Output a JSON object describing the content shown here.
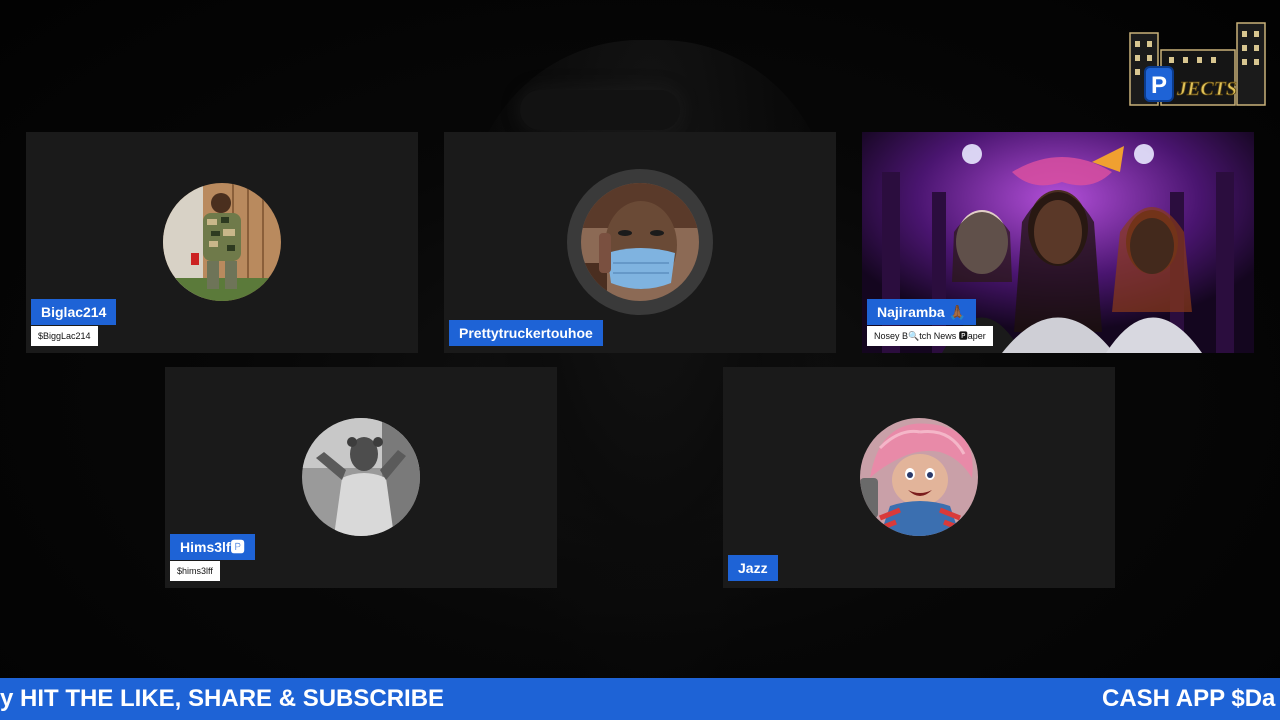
{
  "colors": {
    "accent": "#1e63d6",
    "tile_bg": "#1a1a1a",
    "background": "#040404",
    "sub_tag_bg": "#ffffff"
  },
  "logo": {
    "icon": "projects-building-logo",
    "letter": "P",
    "text": "JECTS"
  },
  "participants": [
    {
      "name": "Biglac214",
      "subtitle": "$BiggLac214",
      "avatar": "camouflage-jacket-person-avatar"
    },
    {
      "name": "Prettytruckertouhoe",
      "subtitle": "",
      "avatar": "face-mask-person-avatar"
    },
    {
      "name": "Najiramba 🙏🏾",
      "subtitle": "Nosey B🔍tch News 🅿aper",
      "avatar": "three-women-purple-stage-photo"
    },
    {
      "name": "Hims3lf🅿",
      "subtitle": "$hims3lff",
      "avatar": "grayscale-person-avatar"
    },
    {
      "name": "Jazz",
      "subtitle": "",
      "avatar": "chucky-doll-avatar"
    }
  ],
  "ticker": {
    "left_text": "y HIT THE LIKE, SHARE & SUBSCRIBE",
    "right_text": "CASH APP $Da"
  }
}
